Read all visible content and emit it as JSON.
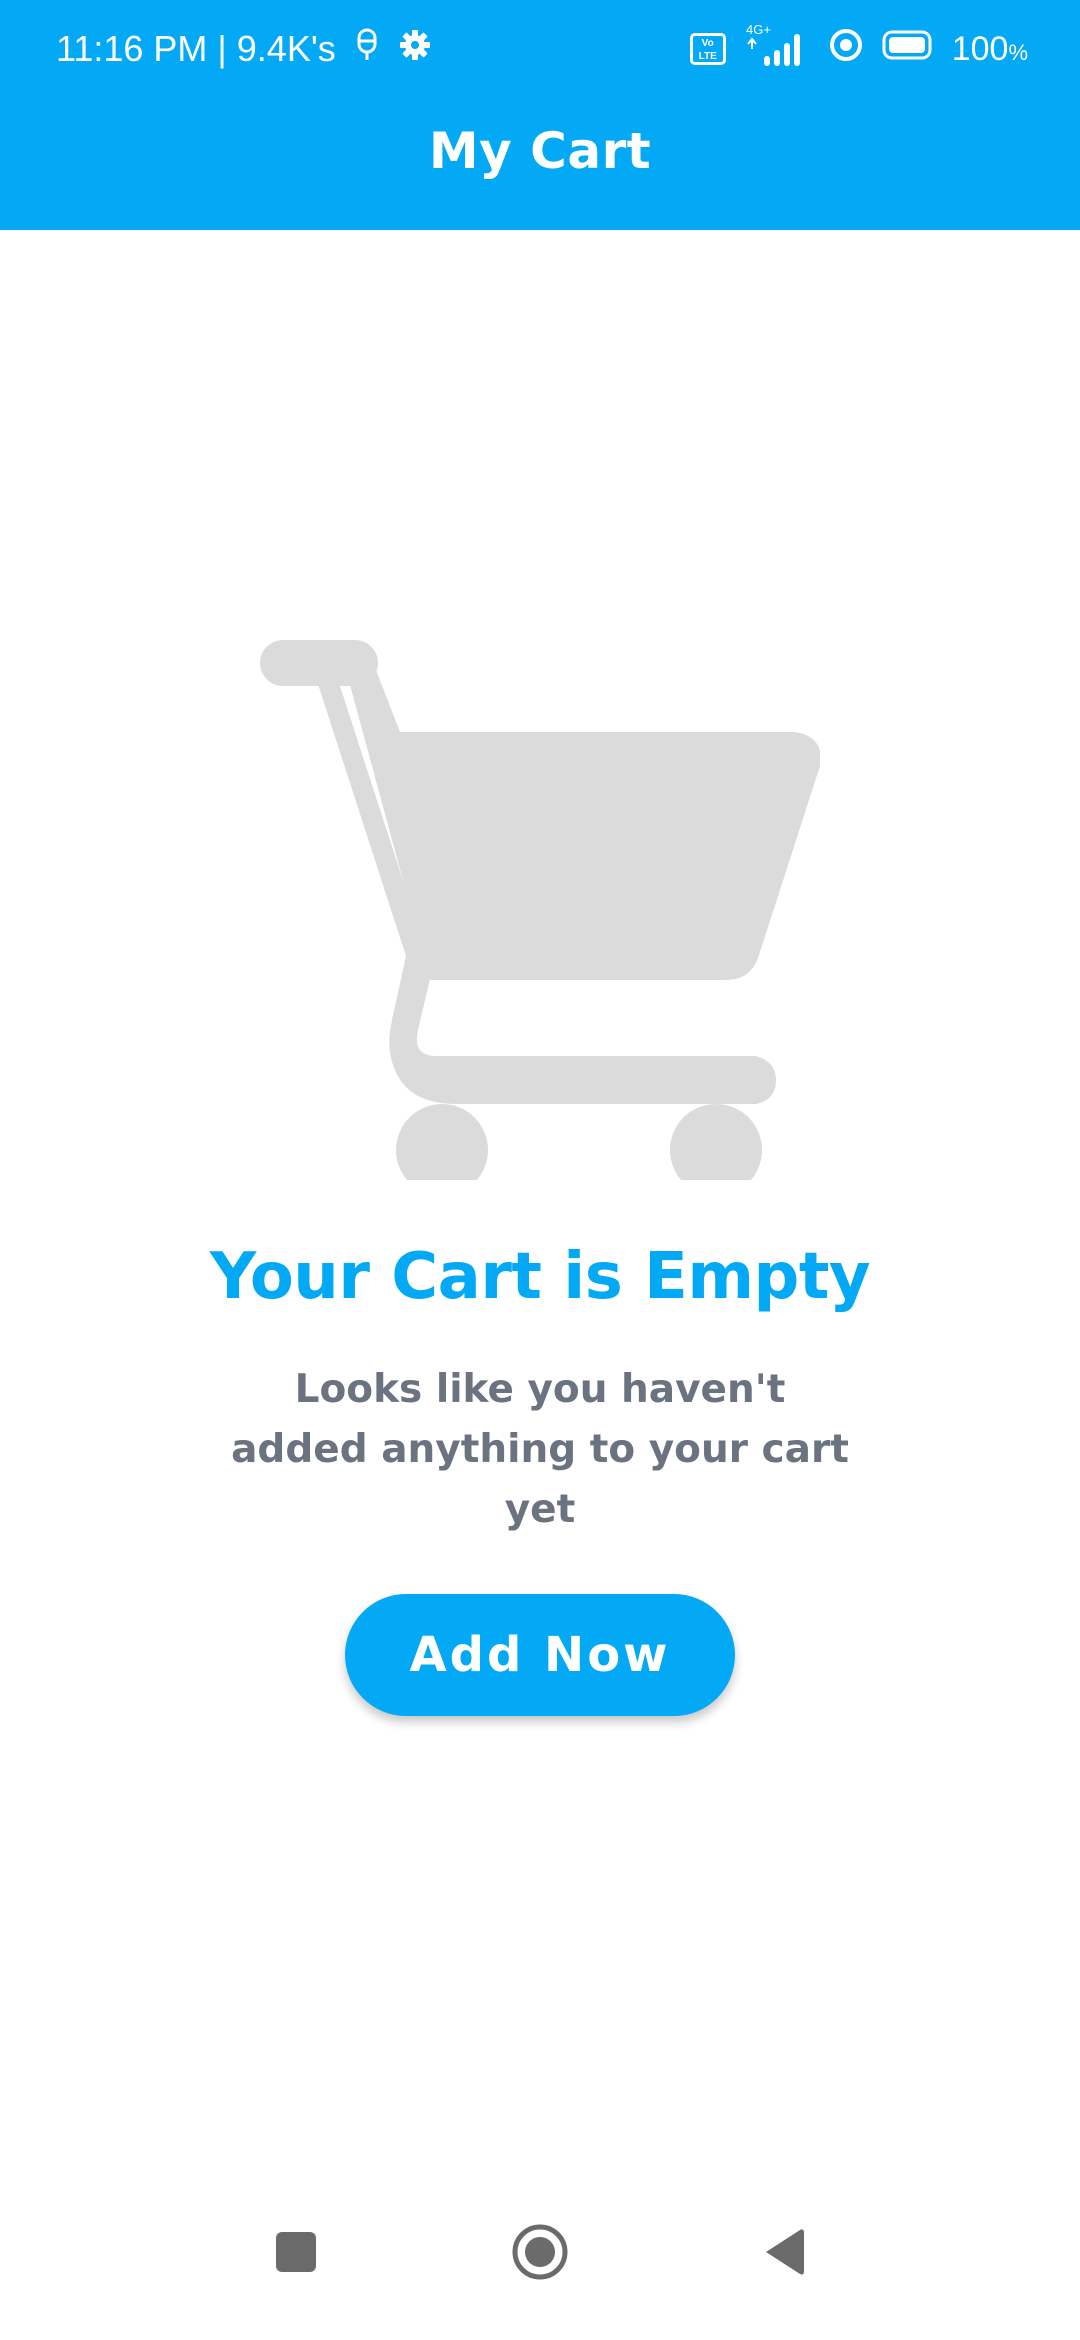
{
  "status_bar": {
    "time": "11:16 PM | 9.4K's",
    "battery": "100",
    "battery_suffix": "%",
    "network_badge": "Vo LTE",
    "network_type": "4G+",
    "icons": [
      "mic-off-icon",
      "gear-icon",
      "volte-icon",
      "signal-icon",
      "hotspot-icon",
      "battery-icon"
    ]
  },
  "app_bar": {
    "title": "My Cart"
  },
  "empty_state": {
    "illustration": "shopping-cart-icon",
    "title": "Your Cart is Empty",
    "message": "Looks like you haven't added anything to your cart yet",
    "button_label": "Add Now"
  },
  "nav_bar": {
    "items": [
      "recents-icon",
      "home-icon",
      "back-icon"
    ]
  },
  "colors": {
    "primary": "#03A9F4",
    "illustration": "#DBDBDB",
    "message_text": "#6b7280",
    "nav_icons": "#6b6b6b"
  }
}
